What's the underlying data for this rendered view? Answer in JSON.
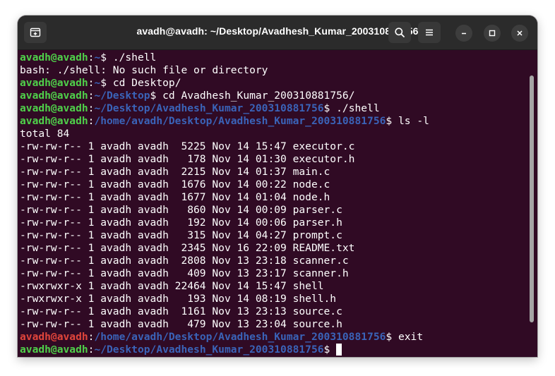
{
  "window": {
    "title": "avadh@avadh: ~/Desktop/Avadhesh_Kumar_200310881756"
  },
  "titlebar": {
    "new_tab_icon": "new-tab-icon",
    "search_icon": "search-icon",
    "menu_icon": "hamburger-menu-icon",
    "minimize_icon": "minimize-icon",
    "maximize_icon": "maximize-icon",
    "close_icon": "close-icon"
  },
  "colors": {
    "background": "#300a24",
    "user_ok": "#4fd04a",
    "user_err": "#e0453b",
    "path": "#3a63b8",
    "text": "#ffffff"
  },
  "terminal": {
    "lines": [
      {
        "user": "avadh@avadh",
        "status": "ok",
        "sep": ":",
        "path": "~",
        "sym": "$ ",
        "cmd": "./shell"
      },
      {
        "text": "bash: ./shell: No such file or directory"
      },
      {
        "user": "avadh@avadh",
        "status": "ok",
        "sep": ":",
        "path": "~",
        "sym": "$ ",
        "cmd": "cd Desktop/"
      },
      {
        "user": "avadh@avadh",
        "status": "ok",
        "sep": ":",
        "path": "~/Desktop",
        "sym": "$ ",
        "cmd": "cd Avadhesh_Kumar_200310881756/"
      },
      {
        "user": "avadh@avadh",
        "status": "ok",
        "sep": ":",
        "path": "~/Desktop/Avadhesh_Kumar_200310881756",
        "sym": "$ ",
        "cmd": "./shell"
      },
      {
        "user": "avadh@avadh",
        "status": "ok",
        "sep": ":",
        "path": "/home/avadh/Desktop/Avadhesh_Kumar_200310881756",
        "sym": "$ ",
        "cmd": "ls -l"
      },
      {
        "text": "total 84"
      },
      {
        "text": "-rw-rw-r-- 1 avadh avadh  5225 Nov 14 15:47 executor.c"
      },
      {
        "text": "-rw-rw-r-- 1 avadh avadh   178 Nov 14 01:30 executor.h"
      },
      {
        "text": "-rw-rw-r-- 1 avadh avadh  2215 Nov 14 01:37 main.c"
      },
      {
        "text": "-rw-rw-r-- 1 avadh avadh  1676 Nov 14 00:22 node.c"
      },
      {
        "text": "-rw-rw-r-- 1 avadh avadh  1677 Nov 14 01:04 node.h"
      },
      {
        "text": "-rw-rw-r-- 1 avadh avadh   860 Nov 14 00:09 parser.c"
      },
      {
        "text": "-rw-rw-r-- 1 avadh avadh   192 Nov 14 00:06 parser.h"
      },
      {
        "text": "-rw-rw-r-- 1 avadh avadh   315 Nov 14 04:27 prompt.c"
      },
      {
        "text": "-rw-rw-r-- 1 avadh avadh  2345 Nov 16 22:09 README.txt"
      },
      {
        "text": "-rw-rw-r-- 1 avadh avadh  2808 Nov 13 23:18 scanner.c"
      },
      {
        "text": "-rw-rw-r-- 1 avadh avadh   409 Nov 13 23:17 scanner.h"
      },
      {
        "text": "-rwxrwxr-x 1 avadh avadh 22464 Nov 14 15:47 shell"
      },
      {
        "text": "-rwxrwxr-x 1 avadh avadh   193 Nov 14 08:19 shell.h"
      },
      {
        "text": "-rw-rw-r-- 1 avadh avadh  1161 Nov 13 23:13 source.c"
      },
      {
        "text": "-rw-rw-r-- 1 avadh avadh   479 Nov 13 23:04 source.h"
      },
      {
        "user": "avadh@avadh",
        "status": "err",
        "sep": ":",
        "path": "/home/avadh/Desktop/Avadhesh_Kumar_200310881756",
        "sym": "$ ",
        "cmd": "exit"
      },
      {
        "user": "avadh@avadh",
        "status": "ok",
        "sep": ":",
        "path": "~/Desktop/Avadhesh_Kumar_200310881756",
        "sym": "$ ",
        "cmd": "",
        "cursor": true
      }
    ]
  }
}
